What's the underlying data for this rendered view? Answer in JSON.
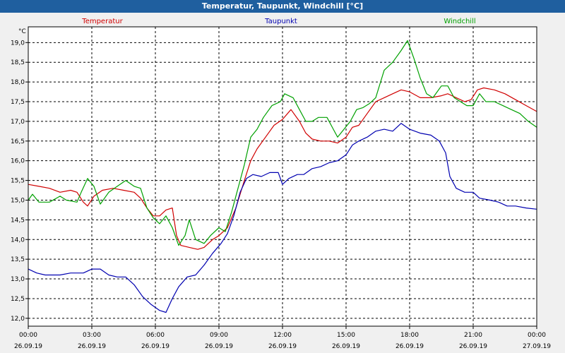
{
  "window": {
    "title": "Temperatur, Taupunkt, Windchill [°C]"
  },
  "chart_data": {
    "type": "line",
    "title": "Temperatur, Taupunkt, Windchill [°C]",
    "ylabel": "°C",
    "ylim": [
      11.8,
      19.4
    ],
    "xlim": [
      0,
      24
    ],
    "yticks": [
      12.0,
      12.5,
      13.0,
      13.5,
      14.0,
      14.5,
      15.0,
      15.5,
      16.0,
      16.5,
      17.0,
      17.5,
      18.0,
      18.5,
      19.0
    ],
    "xticks": [
      {
        "x": 0,
        "time": "00:00",
        "date": "26.09.19"
      },
      {
        "x": 3,
        "time": "03:00",
        "date": "26.09.19"
      },
      {
        "x": 6,
        "time": "06:00",
        "date": "26.09.19"
      },
      {
        "x": 9,
        "time": "09:00",
        "date": "26.09.19"
      },
      {
        "x": 12,
        "time": "12:00",
        "date": "26.09.19"
      },
      {
        "x": 15,
        "time": "15:00",
        "date": "26.09.19"
      },
      {
        "x": 18,
        "time": "18:00",
        "date": "26.09.19"
      },
      {
        "x": 21,
        "time": "21:00",
        "date": "26.09.19"
      },
      {
        "x": 24,
        "time": "00:00",
        "date": "27.09.19"
      }
    ],
    "grid": true,
    "legend_position": "top",
    "series": [
      {
        "name": "Temperatur",
        "color": "#d00000",
        "points": [
          [
            0,
            15.4
          ],
          [
            0.5,
            15.35
          ],
          [
            1,
            15.3
          ],
          [
            1.5,
            15.2
          ],
          [
            2,
            15.25
          ],
          [
            2.3,
            15.2
          ],
          [
            2.6,
            14.95
          ],
          [
            2.8,
            14.85
          ],
          [
            3.1,
            15.1
          ],
          [
            3.5,
            15.25
          ],
          [
            4,
            15.3
          ],
          [
            4.5,
            15.25
          ],
          [
            5,
            15.2
          ],
          [
            5.3,
            15.05
          ],
          [
            5.6,
            14.8
          ],
          [
            5.9,
            14.6
          ],
          [
            6.2,
            14.6
          ],
          [
            6.5,
            14.75
          ],
          [
            6.8,
            14.8
          ],
          [
            7,
            14.1
          ],
          [
            7.2,
            13.85
          ],
          [
            7.6,
            13.8
          ],
          [
            8,
            13.75
          ],
          [
            8.3,
            13.8
          ],
          [
            8.7,
            14.0
          ],
          [
            9,
            14.1
          ],
          [
            9.4,
            14.3
          ],
          [
            9.8,
            14.8
          ],
          [
            10.2,
            15.5
          ],
          [
            10.5,
            16.0
          ],
          [
            10.8,
            16.3
          ],
          [
            11.2,
            16.6
          ],
          [
            11.6,
            16.9
          ],
          [
            12,
            17.05
          ],
          [
            12.4,
            17.3
          ],
          [
            12.8,
            17.0
          ],
          [
            13.1,
            16.7
          ],
          [
            13.4,
            16.55
          ],
          [
            13.8,
            16.5
          ],
          [
            14.2,
            16.5
          ],
          [
            14.6,
            16.45
          ],
          [
            15,
            16.6
          ],
          [
            15.3,
            16.85
          ],
          [
            15.6,
            16.9
          ],
          [
            16,
            17.2
          ],
          [
            16.4,
            17.5
          ],
          [
            16.8,
            17.6
          ],
          [
            17.2,
            17.7
          ],
          [
            17.6,
            17.8
          ],
          [
            18,
            17.75
          ],
          [
            18.5,
            17.6
          ],
          [
            19,
            17.6
          ],
          [
            19.5,
            17.65
          ],
          [
            19.8,
            17.7
          ],
          [
            20.2,
            17.6
          ],
          [
            20.6,
            17.5
          ],
          [
            20.9,
            17.55
          ],
          [
            21.2,
            17.8
          ],
          [
            21.5,
            17.85
          ],
          [
            22,
            17.8
          ],
          [
            22.5,
            17.7
          ],
          [
            23,
            17.55
          ],
          [
            23.5,
            17.4
          ],
          [
            24,
            17.25
          ]
        ]
      },
      {
        "name": "Taupunkt",
        "color": "#0000b0",
        "points": [
          [
            0,
            13.25
          ],
          [
            0.4,
            13.15
          ],
          [
            0.8,
            13.1
          ],
          [
            1.5,
            13.1
          ],
          [
            2,
            13.15
          ],
          [
            2.6,
            13.15
          ],
          [
            3,
            13.25
          ],
          [
            3.4,
            13.25
          ],
          [
            3.8,
            13.1
          ],
          [
            4.2,
            13.05
          ],
          [
            4.6,
            13.05
          ],
          [
            5,
            12.85
          ],
          [
            5.4,
            12.55
          ],
          [
            5.8,
            12.35
          ],
          [
            6.2,
            12.2
          ],
          [
            6.5,
            12.15
          ],
          [
            6.8,
            12.5
          ],
          [
            7.1,
            12.8
          ],
          [
            7.5,
            13.05
          ],
          [
            7.9,
            13.1
          ],
          [
            8.3,
            13.35
          ],
          [
            8.7,
            13.65
          ],
          [
            9.1,
            13.9
          ],
          [
            9.4,
            14.15
          ],
          [
            9.7,
            14.6
          ],
          [
            10,
            15.2
          ],
          [
            10.3,
            15.55
          ],
          [
            10.6,
            15.65
          ],
          [
            11,
            15.6
          ],
          [
            11.4,
            15.7
          ],
          [
            11.8,
            15.7
          ],
          [
            12,
            15.4
          ],
          [
            12.3,
            15.55
          ],
          [
            12.7,
            15.65
          ],
          [
            13,
            15.65
          ],
          [
            13.4,
            15.8
          ],
          [
            13.8,
            15.85
          ],
          [
            14.2,
            15.95
          ],
          [
            14.6,
            16.0
          ],
          [
            15,
            16.15
          ],
          [
            15.3,
            16.4
          ],
          [
            15.6,
            16.5
          ],
          [
            16,
            16.6
          ],
          [
            16.4,
            16.75
          ],
          [
            16.8,
            16.8
          ],
          [
            17.2,
            16.75
          ],
          [
            17.6,
            16.95
          ],
          [
            18,
            16.8
          ],
          [
            18.5,
            16.7
          ],
          [
            19,
            16.65
          ],
          [
            19.4,
            16.5
          ],
          [
            19.7,
            16.2
          ],
          [
            19.9,
            15.6
          ],
          [
            20.2,
            15.3
          ],
          [
            20.6,
            15.2
          ],
          [
            21,
            15.2
          ],
          [
            21.3,
            15.05
          ],
          [
            21.8,
            15.0
          ],
          [
            22.2,
            14.95
          ],
          [
            22.6,
            14.85
          ],
          [
            23,
            14.85
          ],
          [
            23.5,
            14.8
          ],
          [
            24,
            14.77
          ]
        ]
      },
      {
        "name": "Windchill",
        "color": "#00a000",
        "points": [
          [
            0,
            15.0
          ],
          [
            0.2,
            15.15
          ],
          [
            0.5,
            14.95
          ],
          [
            1,
            14.95
          ],
          [
            1.5,
            15.1
          ],
          [
            1.8,
            15.0
          ],
          [
            2.3,
            14.95
          ],
          [
            2.5,
            15.2
          ],
          [
            2.8,
            15.55
          ],
          [
            3.1,
            15.35
          ],
          [
            3.4,
            14.9
          ],
          [
            3.8,
            15.2
          ],
          [
            4.2,
            15.35
          ],
          [
            4.6,
            15.5
          ],
          [
            5,
            15.35
          ],
          [
            5.3,
            15.3
          ],
          [
            5.6,
            14.8
          ],
          [
            5.9,
            14.55
          ],
          [
            6.2,
            14.4
          ],
          [
            6.5,
            14.6
          ],
          [
            6.8,
            14.3
          ],
          [
            7.1,
            13.85
          ],
          [
            7.4,
            14.1
          ],
          [
            7.6,
            14.5
          ],
          [
            7.9,
            14.0
          ],
          [
            8.3,
            13.9
          ],
          [
            8.6,
            14.1
          ],
          [
            9,
            14.3
          ],
          [
            9.3,
            14.2
          ],
          [
            9.6,
            14.7
          ],
          [
            9.9,
            15.3
          ],
          [
            10.2,
            15.9
          ],
          [
            10.5,
            16.6
          ],
          [
            10.8,
            16.8
          ],
          [
            11.1,
            17.1
          ],
          [
            11.5,
            17.4
          ],
          [
            11.9,
            17.5
          ],
          [
            12.1,
            17.7
          ],
          [
            12.5,
            17.6
          ],
          [
            12.8,
            17.3
          ],
          [
            13.1,
            17.0
          ],
          [
            13.4,
            17.0
          ],
          [
            13.7,
            17.1
          ],
          [
            14.1,
            17.1
          ],
          [
            14.4,
            16.8
          ],
          [
            14.6,
            16.6
          ],
          [
            14.9,
            16.8
          ],
          [
            15.2,
            17.0
          ],
          [
            15.5,
            17.3
          ],
          [
            15.8,
            17.35
          ],
          [
            16.1,
            17.45
          ],
          [
            16.4,
            17.6
          ],
          [
            16.8,
            18.3
          ],
          [
            17.2,
            18.5
          ],
          [
            17.6,
            18.8
          ],
          [
            17.9,
            19.05
          ],
          [
            18.2,
            18.6
          ],
          [
            18.5,
            18.1
          ],
          [
            18.8,
            17.7
          ],
          [
            19.1,
            17.6
          ],
          [
            19.5,
            17.9
          ],
          [
            19.8,
            17.9
          ],
          [
            20.1,
            17.6
          ],
          [
            20.4,
            17.5
          ],
          [
            20.7,
            17.4
          ],
          [
            21,
            17.4
          ],
          [
            21.3,
            17.7
          ],
          [
            21.6,
            17.5
          ],
          [
            22,
            17.5
          ],
          [
            22.4,
            17.4
          ],
          [
            22.8,
            17.3
          ],
          [
            23.2,
            17.2
          ],
          [
            23.6,
            17.0
          ],
          [
            24,
            16.85
          ]
        ]
      }
    ]
  }
}
